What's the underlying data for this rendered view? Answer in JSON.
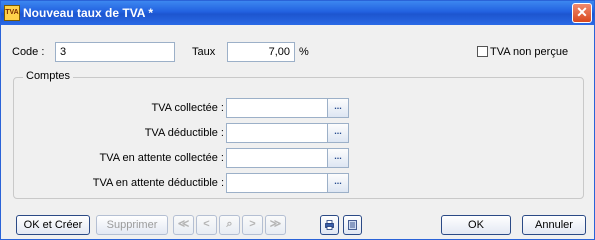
{
  "window": {
    "title": "Nouveau taux de TVA *",
    "close_glyph": "✕"
  },
  "fields": {
    "code_label": "Code :",
    "code_value": "3",
    "taux_label": "Taux",
    "taux_value": "7,00",
    "percent_symbol": "%",
    "tva_non_percue_label": "TVA non perçue",
    "tva_non_percue_checked": false
  },
  "comptes": {
    "legend": "Comptes",
    "rows": [
      {
        "label": "TVA collectée :",
        "value": "",
        "picker": "..."
      },
      {
        "label": "TVA déductible :",
        "value": "",
        "picker": "..."
      },
      {
        "label": "TVA en attente collectée :",
        "value": "",
        "picker": "..."
      },
      {
        "label": "TVA en attente déductible :",
        "value": "",
        "picker": "..."
      }
    ]
  },
  "toolbar": {
    "ok_create": "OK et Créer",
    "delete": "Supprimer",
    "first": "≪",
    "prev": "<",
    "search": "⌕",
    "next": ">",
    "last": "≫",
    "print_icon": "printer-icon",
    "view_icon": "document-view-icon",
    "ok": "OK",
    "cancel": "Annuler"
  },
  "colors": {
    "title_bar": "#2261e0",
    "close_button": "#d9481e",
    "accent_border": "#2b4a86"
  }
}
